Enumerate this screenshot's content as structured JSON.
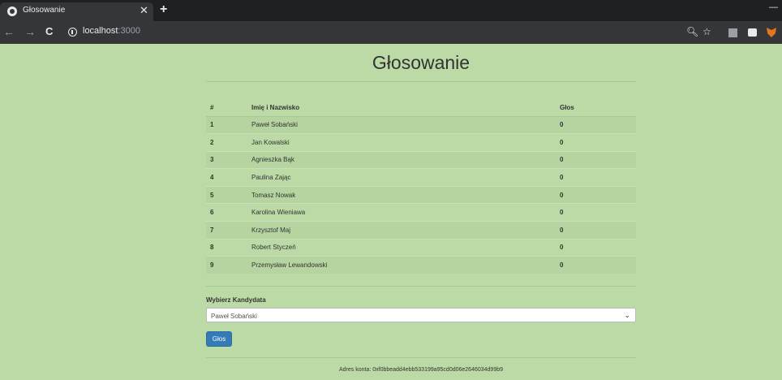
{
  "browser": {
    "tab_title": "Głosowanie",
    "url_host": "localhost",
    "url_port": ":3000"
  },
  "page": {
    "title": "Głosowanie",
    "table": {
      "headers": [
        "#",
        "Imię i Nazwisko",
        "Głos"
      ],
      "rows": [
        [
          "1",
          "Paweł Sobański",
          "0"
        ],
        [
          "2",
          "Jan Kowalski",
          "0"
        ],
        [
          "3",
          "Agnieszka Bąk",
          "0"
        ],
        [
          "4",
          "Paulina Zając",
          "0"
        ],
        [
          "5",
          "Tomasz Nowak",
          "0"
        ],
        [
          "6",
          "Karolina Wieniawa",
          "0"
        ],
        [
          "7",
          "Krzysztof Maj",
          "0"
        ],
        [
          "8",
          "Robert Styczeń",
          "0"
        ],
        [
          "9",
          "Przemysław Lewandowski",
          "0"
        ]
      ]
    },
    "select_label": "Wybierz Kandydata",
    "select_value": "Paweł Sobański",
    "vote_button": "Głos",
    "account_address": "Adres konta: 0xf0bbeadd4ebb533199a95cd0d06e2646034d99b9"
  },
  "colors": {
    "page_background": "#bcdaa6",
    "button": "#337ab7"
  }
}
